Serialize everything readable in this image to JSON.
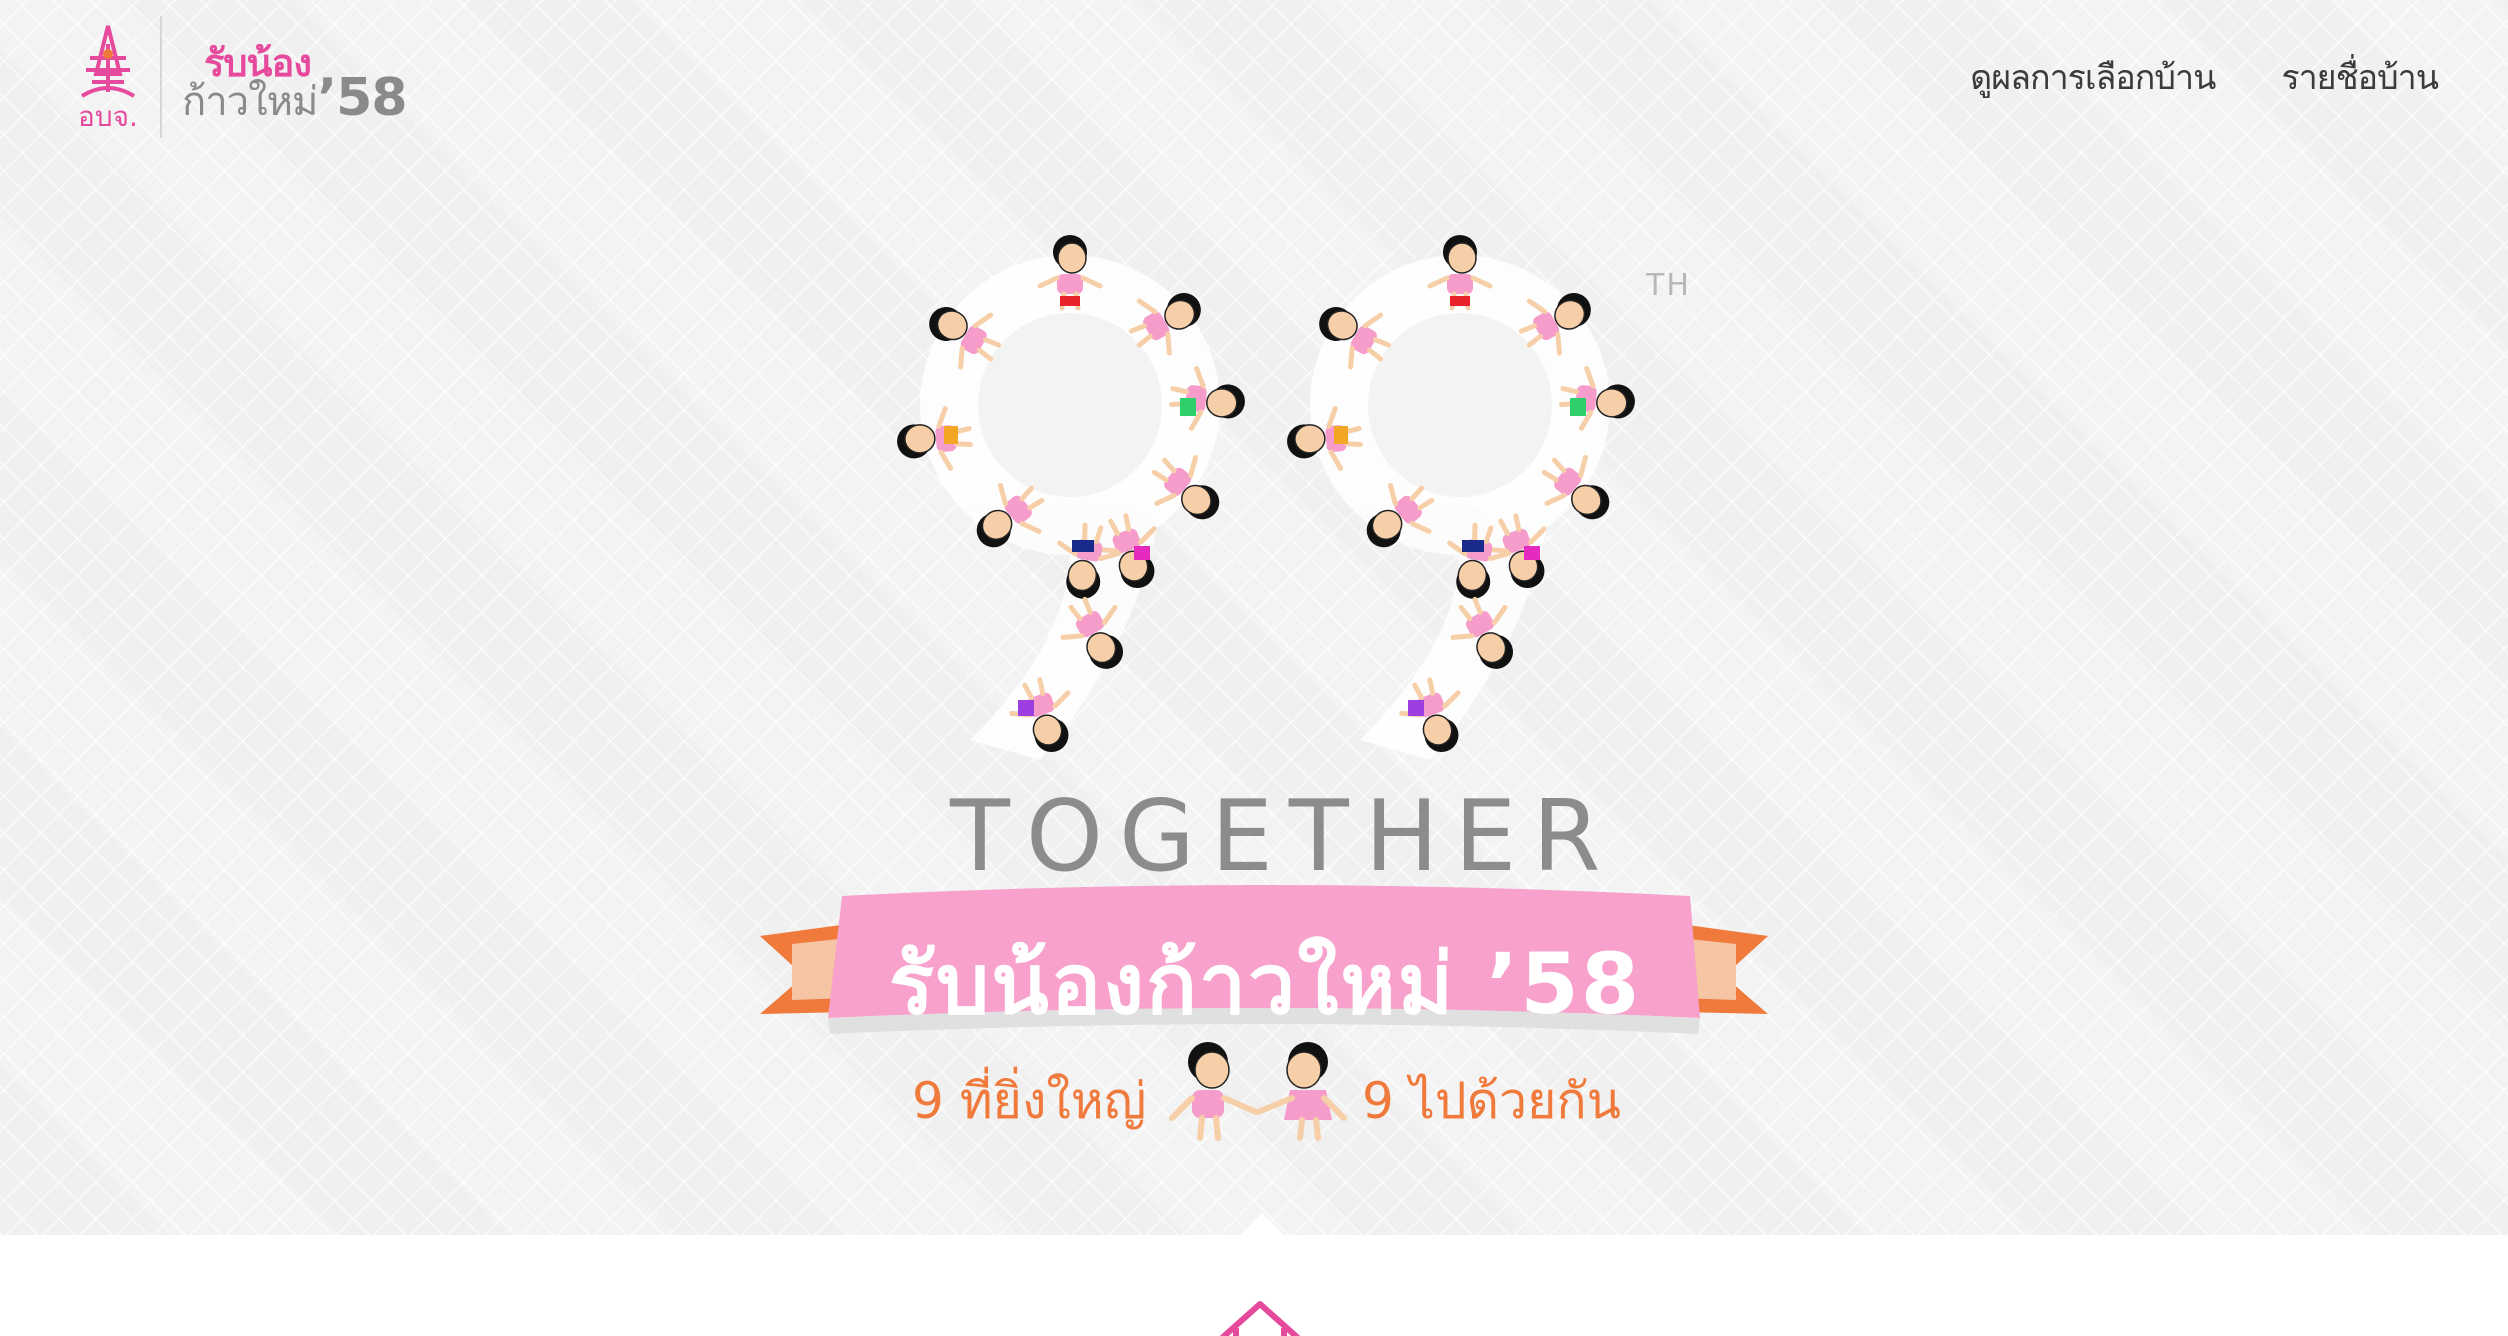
{
  "header": {
    "logo_text": "อบจ.",
    "brand_line1": "รับน้อง",
    "brand_line2_prefix": "ก้าวใหม่",
    "brand_year": "’58"
  },
  "nav": {
    "items": [
      {
        "label": "ดูผลการเลือกบ้าน"
      },
      {
        "label": "รายชื่อบ้าน"
      }
    ]
  },
  "hero": {
    "number_icon": "99-children-circle",
    "superscript": "TH",
    "together": "TOGETHER",
    "ribbon_text": "รับน้องก้าวใหม่ ’58",
    "tagline_left": "9  ที่ยิ่งใหญ่",
    "tagline_right": "9 ไปด้วยกัน"
  },
  "colors": {
    "brand_pink": "#e64a9c",
    "ribbon_pink": "#f7a1cc",
    "orange": "#f07a3c",
    "gray_text": "#8c8c8c"
  },
  "footer_icon": "home-icon"
}
